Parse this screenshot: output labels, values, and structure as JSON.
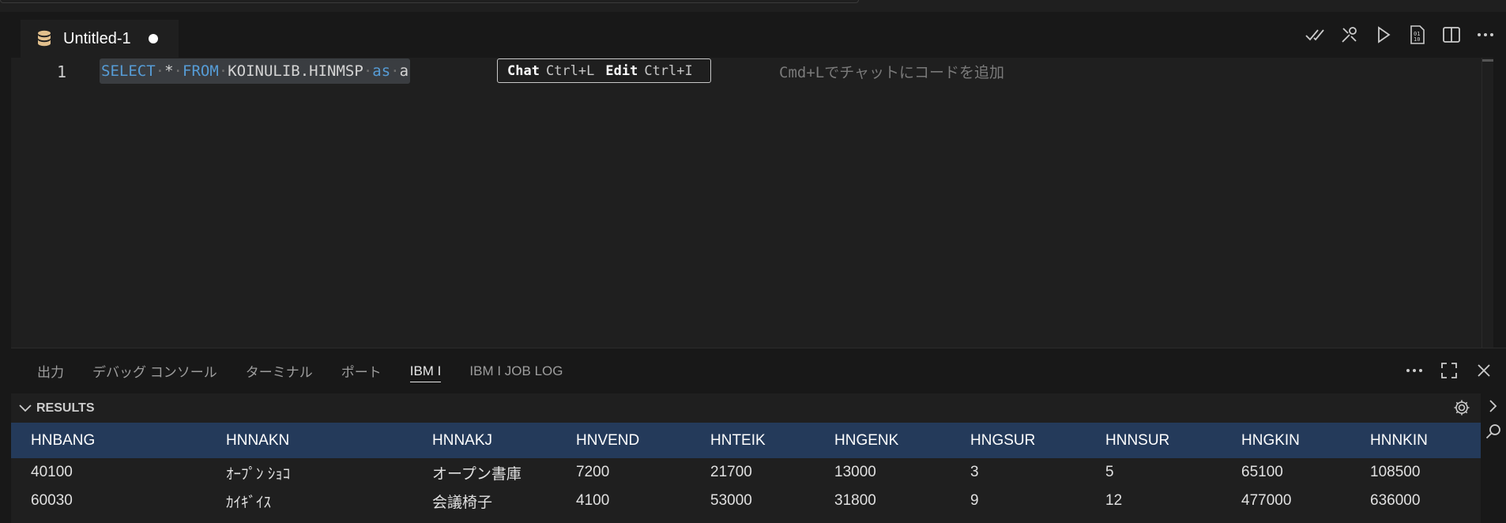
{
  "tab": {
    "title": "Untitled-1"
  },
  "editor": {
    "line_number": "1",
    "code": {
      "kw_select": "SELECT",
      "star": "*",
      "kw_from": "FROM",
      "table": "KOINULIB.HINMSP",
      "kw_as": "as",
      "alias": "a"
    },
    "hint": {
      "chat_label": "Chat",
      "chat_key": "Ctrl+L",
      "edit_label": "Edit",
      "edit_key": "Ctrl+I"
    },
    "ghost_text": "Cmd+Lでチャットにコードを追加"
  },
  "panel": {
    "tabs": [
      "出力",
      "デバッグ コンソール",
      "ターミナル",
      "ポート",
      "IBM I",
      "IBM I JOB LOG"
    ],
    "active_tab": "IBM I",
    "results_label": "RESULTS"
  },
  "results": {
    "columns": [
      "HNBANG",
      "HNNAKN",
      "HNNAKJ",
      "HNVEND",
      "HNTEIK",
      "HNGENK",
      "HNGSUR",
      "HNNSUR",
      "HNGKIN",
      "HNNKIN"
    ],
    "rows": [
      [
        "40100",
        "ｵｰﾌﾟﾝ ｼｮｺ",
        "オープン書庫",
        "7200",
        "21700",
        "13000",
        "3",
        "5",
        "65100",
        "108500"
      ],
      [
        "60030",
        "ｶｲｷﾞｲｽ",
        "会議椅子",
        "4100",
        "53000",
        "31800",
        "9",
        "12",
        "477000",
        "636000"
      ]
    ]
  },
  "colors": {
    "accent_header": "#243a5a",
    "keyword": "#569cd6",
    "db_icon": "#e2c08d"
  },
  "icons": {
    "tab": "database-icon",
    "editor_actions": [
      "check-all-icon",
      "tools-icon",
      "run-icon",
      "binary-file-icon",
      "split-editor-icon",
      "more-icon"
    ],
    "panel_actions": [
      "more-icon",
      "maximize-icon",
      "close-icon"
    ]
  }
}
